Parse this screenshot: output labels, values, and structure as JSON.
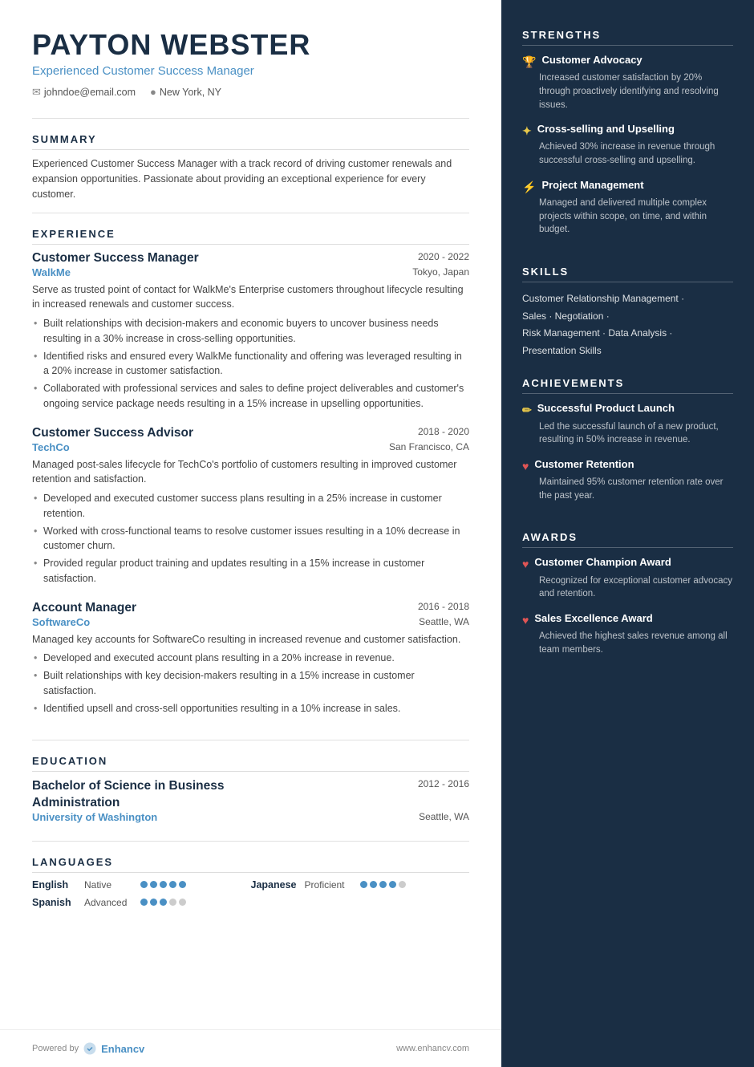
{
  "header": {
    "name": "PAYTON WEBSTER",
    "subtitle": "Experienced Customer Success Manager",
    "email": "johndoe@email.com",
    "location": "New York, NY"
  },
  "summary": {
    "section_title": "SUMMARY",
    "text": "Experienced Customer Success Manager with a track record of driving customer renewals and expansion opportunities. Passionate about providing an exceptional experience for every customer."
  },
  "experience": {
    "section_title": "EXPERIENCE",
    "jobs": [
      {
        "title": "Customer Success Manager",
        "company": "WalkMe",
        "dates": "2020 - 2022",
        "location": "Tokyo, Japan",
        "description": "Serve as trusted point of contact for WalkMe's Enterprise customers throughout lifecycle resulting in increased renewals and customer success.",
        "bullets": [
          "Built relationships with decision-makers and economic buyers to uncover business needs resulting in a 30% increase in cross-selling opportunities.",
          "Identified risks and ensured every WalkMe functionality and offering was leveraged resulting in a 20% increase in customer satisfaction.",
          "Collaborated with professional services and sales to define project deliverables and customer's ongoing service package needs resulting in a 15% increase in upselling opportunities."
        ]
      },
      {
        "title": "Customer Success Advisor",
        "company": "TechCo",
        "dates": "2018 - 2020",
        "location": "San Francisco, CA",
        "description": "Managed post-sales lifecycle for TechCo's portfolio of customers resulting in improved customer retention and satisfaction.",
        "bullets": [
          "Developed and executed customer success plans resulting in a 25% increase in customer retention.",
          "Worked with cross-functional teams to resolve customer issues resulting in a 10% decrease in customer churn.",
          "Provided regular product training and updates resulting in a 15% increase in customer satisfaction."
        ]
      },
      {
        "title": "Account Manager",
        "company": "SoftwareCo",
        "dates": "2016 - 2018",
        "location": "Seattle, WA",
        "description": "Managed key accounts for SoftwareCo resulting in increased revenue and customer satisfaction.",
        "bullets": [
          "Developed and executed account plans resulting in a 20% increase in revenue.",
          "Built relationships with key decision-makers resulting in a 15% increase in customer satisfaction.",
          "Identified upsell and cross-sell opportunities resulting in a 10% increase in sales."
        ]
      }
    ]
  },
  "education": {
    "section_title": "EDUCATION",
    "entries": [
      {
        "degree": "Bachelor of Science in Business Administration",
        "school": "University of Washington",
        "dates": "2012 - 2016",
        "location": "Seattle, WA"
      }
    ]
  },
  "languages": {
    "section_title": "LANGUAGES",
    "items": [
      {
        "name": "English",
        "level": "Native",
        "dots": 5,
        "max": 5
      },
      {
        "name": "Japanese",
        "level": "Proficient",
        "dots": 4,
        "max": 5
      },
      {
        "name": "Spanish",
        "level": "Advanced",
        "dots": 3,
        "max": 5
      }
    ]
  },
  "strengths": {
    "section_title": "STRENGTHS",
    "items": [
      {
        "icon": "🏆",
        "title": "Customer Advocacy",
        "desc": "Increased customer satisfaction by 20% through proactively identifying and resolving issues.",
        "icon_color": "gold"
      },
      {
        "icon": "☆",
        "title": "Cross-selling and Upselling",
        "desc": "Achieved 30% increase in revenue through successful cross-selling and upselling.",
        "icon_color": "gold"
      },
      {
        "icon": "⚡",
        "title": "Project Management",
        "desc": "Managed and delivered multiple complex projects within scope, on time, and within budget.",
        "icon_color": "gold"
      }
    ]
  },
  "skills": {
    "section_title": "SKILLS",
    "lines": [
      "Customer Relationship Management ·",
      "Sales · Negotiation ·",
      "Risk Management · Data Analysis ·",
      "Presentation Skills"
    ]
  },
  "achievements": {
    "section_title": "ACHIEVEMENTS",
    "items": [
      {
        "icon": "✏",
        "title": "Successful Product Launch",
        "desc": "Led the successful launch of a new product, resulting in 50% increase in revenue.",
        "icon_type": "pencil"
      },
      {
        "icon": "♥",
        "title": "Customer Retention",
        "desc": "Maintained 95% customer retention rate over the past year.",
        "icon_type": "heart"
      }
    ]
  },
  "awards": {
    "section_title": "AWARDS",
    "items": [
      {
        "icon": "♥",
        "title": "Customer Champion Award",
        "desc": "Recognized for exceptional customer advocacy and retention."
      },
      {
        "icon": "♥",
        "title": "Sales Excellence Award",
        "desc": "Achieved the highest sales revenue among all team members."
      }
    ]
  },
  "footer": {
    "powered_by": "Powered by",
    "brand": "Enhancv",
    "url": "www.enhancv.com"
  }
}
